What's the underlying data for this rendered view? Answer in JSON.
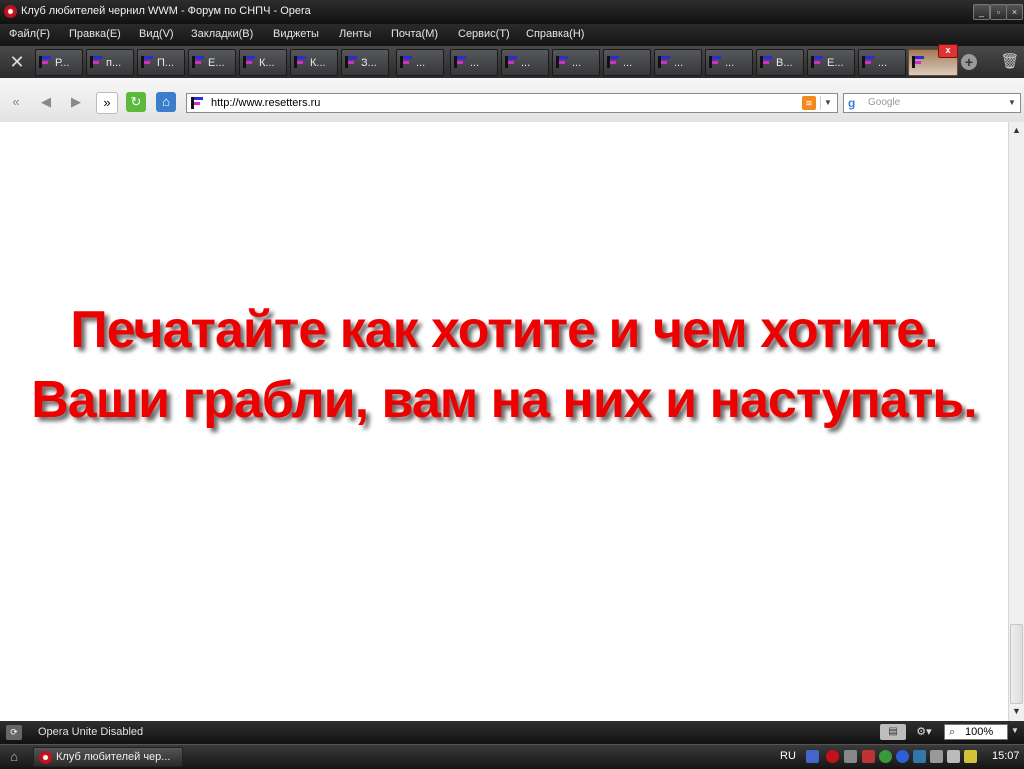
{
  "window": {
    "title": "Клуб любителей чернил WWM - Форум по СНПЧ - Opera"
  },
  "menu": [
    "Файл(F)",
    "Правка(E)",
    "Вид(V)",
    "Закладки(B)",
    "Виджеты",
    "Ленты",
    "Почта(M)",
    "Сервис(T)",
    "Справка(H)"
  ],
  "tabs": [
    {
      "label": "Р..."
    },
    {
      "label": "п..."
    },
    {
      "label": "П..."
    },
    {
      "label": "Е..."
    },
    {
      "label": "К..."
    },
    {
      "label": "К..."
    },
    {
      "label": "З..."
    },
    {
      "label": "..."
    },
    {
      "label": "..."
    },
    {
      "label": "..."
    },
    {
      "label": "..."
    },
    {
      "label": "..."
    },
    {
      "label": "..."
    },
    {
      "label": "..."
    },
    {
      "label": "В..."
    },
    {
      "label": "Е..."
    },
    {
      "label": "..."
    },
    {
      "label": ""
    }
  ],
  "address": {
    "url": "http://www.resetters.ru",
    "search_placeholder": "Google"
  },
  "content": {
    "line1": "Печатайте как хотите и чем хотите.",
    "line2": "Ваши грабли, вам на них и наступать."
  },
  "status": {
    "unite": "Opera Unite Disabled",
    "zoom": "100%"
  },
  "taskbar": {
    "item": "Клуб любителей чер...",
    "lang": "RU",
    "clock": "15:07"
  },
  "colors": {
    "headline": "#ee0000",
    "chrome_dark": "#1b1b1b"
  }
}
